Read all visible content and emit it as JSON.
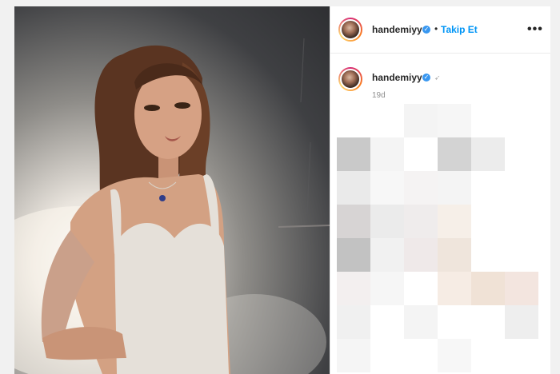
{
  "post": {
    "username": "handemiyy",
    "follow_label": "Takip Et",
    "separator": "•",
    "more_label": "•••",
    "verified_mark": "✓",
    "time_ago": "19d"
  },
  "icons": [
    "verified-badge-icon",
    "more-options-icon",
    "avatar-icon",
    "caption-emoji-icon"
  ],
  "colors": {
    "follow": "#0095f6",
    "verified": "#3897f0",
    "username": "#262626",
    "timestamp": "#8e8e8e"
  }
}
